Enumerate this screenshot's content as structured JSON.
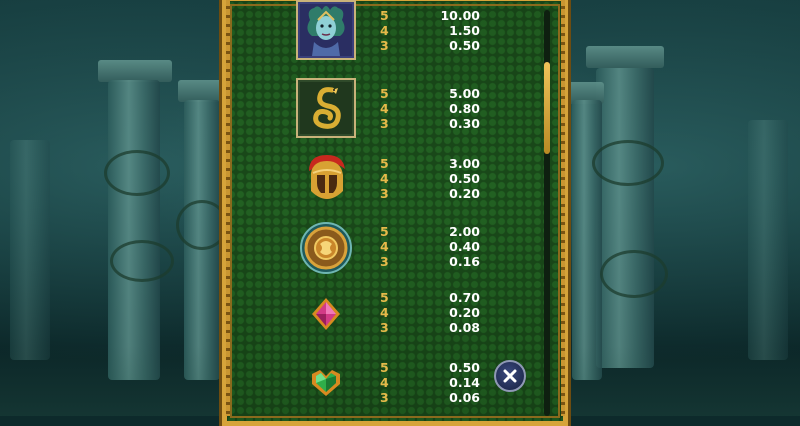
{
  "paytable": {
    "symbols": [
      {
        "icon": "medusa-icon",
        "pays": [
          {
            "count": "5",
            "value": "10.00"
          },
          {
            "count": "4",
            "value": "1.50"
          },
          {
            "count": "3",
            "value": "0.50"
          }
        ]
      },
      {
        "icon": "golden-snake-icon",
        "pays": [
          {
            "count": "5",
            "value": "5.00"
          },
          {
            "count": "4",
            "value": "0.80"
          },
          {
            "count": "3",
            "value": "0.30"
          }
        ]
      },
      {
        "icon": "spartan-helmet-icon",
        "pays": [
          {
            "count": "5",
            "value": "3.00"
          },
          {
            "count": "4",
            "value": "0.50"
          },
          {
            "count": "3",
            "value": "0.20"
          }
        ]
      },
      {
        "icon": "bronze-shield-icon",
        "pays": [
          {
            "count": "5",
            "value": "2.00"
          },
          {
            "count": "4",
            "value": "0.40"
          },
          {
            "count": "3",
            "value": "0.16"
          }
        ]
      },
      {
        "icon": "pink-gem-icon",
        "pays": [
          {
            "count": "5",
            "value": "0.70"
          },
          {
            "count": "4",
            "value": "0.20"
          },
          {
            "count": "3",
            "value": "0.08"
          }
        ]
      },
      {
        "icon": "green-gem-icon",
        "pays": [
          {
            "count": "5",
            "value": "0.50"
          },
          {
            "count": "4",
            "value": "0.14"
          },
          {
            "count": "3",
            "value": "0.06"
          }
        ]
      }
    ]
  },
  "colors": {
    "count_gold": "#e5b94a",
    "value_white": "#ffffff",
    "panel_green": "#226122",
    "frame_gold": "#d6a43a"
  },
  "scroll": {
    "position_fraction": 0.3
  },
  "close": {
    "icon": "close-x-icon"
  }
}
